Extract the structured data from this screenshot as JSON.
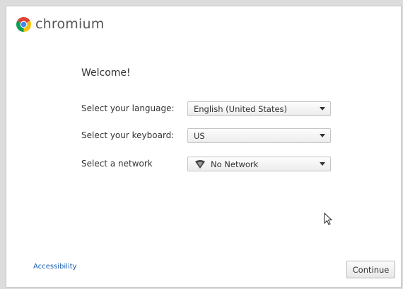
{
  "app": {
    "brand_name": "chromium",
    "brand_colors": {
      "red": "#db4437",
      "yellow": "#f4c20d",
      "green": "#0f9d58",
      "blue": "#4285f4"
    }
  },
  "welcome": {
    "title": "Welcome!"
  },
  "form": {
    "language": {
      "label": "Select your language:",
      "value": "English (United States)"
    },
    "keyboard": {
      "label": "Select your keyboard:",
      "value": "US"
    },
    "network": {
      "label": "Select a network",
      "value": "No Network",
      "icon": "wifi-icon"
    }
  },
  "footer": {
    "accessibility_label": "Accessibility",
    "continue_label": "Continue",
    "link_color": "#1a5fae"
  }
}
